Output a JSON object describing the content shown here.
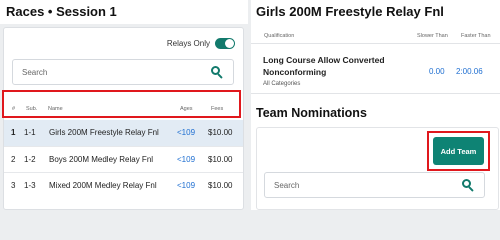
{
  "races_panel": {
    "title": "Races • Session 1",
    "relays_only_label": "Relays Only",
    "relays_only_on": true,
    "search_placeholder": "Search",
    "columns": {
      "num": "#",
      "sub": "Sub.",
      "name": "Name",
      "ages": "Ages",
      "fees": "Fees"
    },
    "races": [
      {
        "num": "1",
        "sub": "1-1",
        "name": "Girls 200M Freestyle Relay Fnl",
        "ages": "<109",
        "fees": "$10.00",
        "selected": true
      },
      {
        "num": "2",
        "sub": "1-2",
        "name": "Boys 200M Medley Relay Fnl",
        "ages": "<109",
        "fees": "$10.00",
        "selected": false
      },
      {
        "num": "3",
        "sub": "1-3",
        "name": "Mixed 200M Medley Relay Fnl",
        "ages": "<109",
        "fees": "$10.00",
        "selected": false
      }
    ]
  },
  "detail_panel": {
    "title": "Girls 200M Freestyle Relay Fnl",
    "qualification_header": {
      "name": "Qualification",
      "slower": "Slower Than",
      "faster": "Faster Than"
    },
    "qualification": {
      "name": "Long Course Allow Converted Nonconforming",
      "category": "All Categories",
      "slower_than": "0.00",
      "faster_than": "2:00.06"
    },
    "team_nominations_title": "Team Nominations",
    "add_team_label": "Add Team",
    "search_placeholder": "Search"
  },
  "colors": {
    "accent": "#0e8374",
    "link": "#1f6fd1",
    "highlight": "#e0181d",
    "selected_row": "#e2ebf4"
  },
  "icons": [
    "search-icon",
    "toggle-switch"
  ]
}
